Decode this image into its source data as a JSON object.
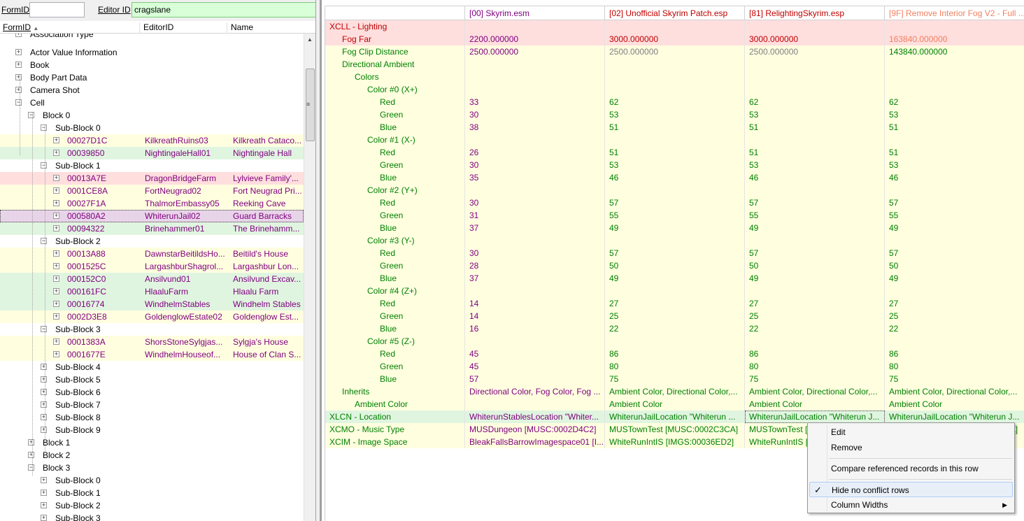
{
  "filter": {
    "formid_label": "FormID",
    "formid_value": "",
    "editorid_label": "Editor ID",
    "editorid_value": "cragslane"
  },
  "tree_header": {
    "col_formid": "FormID",
    "col_editorid": "EditorID",
    "col_name": "Name",
    "sort_icon": "sort-ascending-icon"
  },
  "tree_rows": [
    {
      "level": 1,
      "label": "Association Type",
      "exp": "+",
      "bg": "",
      "partial": true
    },
    {
      "level": 1,
      "label": "Actor Value Information",
      "exp": "+",
      "bg": ""
    },
    {
      "level": 1,
      "label": "Book",
      "exp": "+",
      "bg": ""
    },
    {
      "level": 1,
      "label": "Body Part Data",
      "exp": "+",
      "bg": ""
    },
    {
      "level": 1,
      "label": "Camera Shot",
      "exp": "+",
      "bg": ""
    },
    {
      "level": 1,
      "label": "Cell",
      "exp": "−",
      "bg": ""
    },
    {
      "level": 2,
      "label": "Block 0",
      "exp": "−",
      "bg": ""
    },
    {
      "level": 3,
      "label": "Sub-Block 0",
      "exp": "−",
      "bg": ""
    },
    {
      "level": 4,
      "formid": "00027D1C",
      "editorid": "KilkreathRuins03",
      "name": "Kilkreath Cataco...",
      "exp": "+",
      "bg": "y"
    },
    {
      "level": 4,
      "formid": "00039850",
      "editorid": "NightingaleHall01",
      "name": "Nightingale Hall",
      "exp": "+",
      "bg": "g"
    },
    {
      "level": 3,
      "label": "Sub-Block 1",
      "exp": "−",
      "bg": ""
    },
    {
      "level": 4,
      "formid": "00013A7E",
      "editorid": "DragonBridgeFarm",
      "name": "Lylvieve Family'...",
      "exp": "+",
      "bg": "r"
    },
    {
      "level": 4,
      "formid": "0001CE8A",
      "editorid": "FortNeugrad02",
      "name": "Fort Neugrad Pri...",
      "exp": "+",
      "bg": "y"
    },
    {
      "level": 4,
      "formid": "00027F1A",
      "editorid": "ThalmorEmbassy05",
      "name": "Reeking Cave",
      "exp": "+",
      "bg": "y"
    },
    {
      "level": 4,
      "formid": "000580A2",
      "editorid": "WhiterunJail02",
      "name": "Guard Barracks",
      "exp": "+",
      "bg": "p",
      "selected": true
    },
    {
      "level": 4,
      "formid": "00094322",
      "editorid": "Brinehammer01",
      "name": "The Brinehamm...",
      "exp": "+",
      "bg": "g"
    },
    {
      "level": 3,
      "label": "Sub-Block 2",
      "exp": "−",
      "bg": ""
    },
    {
      "level": 4,
      "formid": "00013A88",
      "editorid": "DawnstarBeitildsHo...",
      "name": "Beitild's House",
      "exp": "+",
      "bg": "y"
    },
    {
      "level": 4,
      "formid": "0001525C",
      "editorid": "LargashburShagrol...",
      "name": "Largashbur Lon...",
      "exp": "+",
      "bg": "y"
    },
    {
      "level": 4,
      "formid": "000152C0",
      "editorid": "Ansilvund01",
      "name": "Ansilvund Excav...",
      "exp": "+",
      "bg": "g"
    },
    {
      "level": 4,
      "formid": "000161FC",
      "editorid": "HlaaluFarm",
      "name": "Hlaalu Farm",
      "exp": "+",
      "bg": "g"
    },
    {
      "level": 4,
      "formid": "00016774",
      "editorid": "WindhelmStables",
      "name": "Windhelm Stables",
      "exp": "+",
      "bg": "g"
    },
    {
      "level": 4,
      "formid": "0002D3E8",
      "editorid": "GoldenglowEstate02",
      "name": "Goldenglow Est...",
      "exp": "+",
      "bg": "y"
    },
    {
      "level": 3,
      "label": "Sub-Block 3",
      "exp": "−",
      "bg": ""
    },
    {
      "level": 4,
      "formid": "0001383A",
      "editorid": "ShorsStoneSylgjas...",
      "name": "Sylgja's House",
      "exp": "+",
      "bg": "y"
    },
    {
      "level": 4,
      "formid": "0001677E",
      "editorid": "WindhelmHouseof...",
      "name": "House of Clan S...",
      "exp": "+",
      "bg": "y"
    },
    {
      "level": 3,
      "label": "Sub-Block 4",
      "exp": "+",
      "bg": ""
    },
    {
      "level": 3,
      "label": "Sub-Block 5",
      "exp": "+",
      "bg": ""
    },
    {
      "level": 3,
      "label": "Sub-Block 6",
      "exp": "+",
      "bg": ""
    },
    {
      "level": 3,
      "label": "Sub-Block 7",
      "exp": "+",
      "bg": ""
    },
    {
      "level": 3,
      "label": "Sub-Block 8",
      "exp": "+",
      "bg": ""
    },
    {
      "level": 3,
      "label": "Sub-Block 9",
      "exp": "+",
      "bg": ""
    },
    {
      "level": 2,
      "label": "Block 1",
      "exp": "+",
      "bg": ""
    },
    {
      "level": 2,
      "label": "Block 2",
      "exp": "+",
      "bg": ""
    },
    {
      "level": 2,
      "label": "Block 3",
      "exp": "−",
      "bg": ""
    },
    {
      "level": 3,
      "label": "Sub-Block 0",
      "exp": "+",
      "bg": ""
    },
    {
      "level": 3,
      "label": "Sub-Block 1",
      "exp": "+",
      "bg": ""
    },
    {
      "level": 3,
      "label": "Sub-Block 2",
      "exp": "+",
      "bg": ""
    },
    {
      "level": 3,
      "label": "Sub-Block 3",
      "exp": "+",
      "bg": ""
    }
  ],
  "grid_header": [
    {
      "text": "",
      "color": ""
    },
    {
      "text": "[00] Skyrim.esm",
      "color": "purple"
    },
    {
      "text": "[02] Unofficial Skyrim Patch.esp",
      "color": "red"
    },
    {
      "text": "[81] RelightingSkyrim.esp",
      "color": "red"
    },
    {
      "text": "[9F] Remove Interior Fog V2 - Full ...",
      "color": "orange"
    }
  ],
  "grid_rows": [
    {
      "lvl": 0,
      "label": "XCLL - Lighting",
      "lc": "red",
      "bg": "r",
      "v": [
        "",
        "",
        "",
        ""
      ],
      "vc": [
        "",
        "",
        "",
        ""
      ]
    },
    {
      "lvl": 1,
      "label": "Fog Far",
      "lc": "red",
      "bg": "r",
      "v": [
        "2200.000000",
        "3000.000000",
        "3000.000000",
        "163840.000000"
      ],
      "vc": [
        "purple",
        "red",
        "red",
        "orange"
      ]
    },
    {
      "lvl": 1,
      "label": "Fog Clip Distance",
      "lc": "green",
      "bg": "y",
      "v": [
        "2500.000000",
        "2500.000000",
        "2500.000000",
        "143840.000000"
      ],
      "vc": [
        "purple",
        "gray",
        "gray",
        "green"
      ]
    },
    {
      "lvl": 1,
      "label": "Directional Ambient",
      "lc": "green",
      "bg": "y",
      "v": [
        "",
        "",
        "",
        ""
      ],
      "vc": [
        "",
        "",
        "",
        ""
      ]
    },
    {
      "lvl": 2,
      "label": "Colors",
      "lc": "green",
      "bg": "y",
      "v": [
        "",
        "",
        "",
        ""
      ],
      "vc": [
        "",
        "",
        "",
        ""
      ]
    },
    {
      "lvl": 3,
      "label": "Color #0 (X+)",
      "lc": "green",
      "bg": "y",
      "v": [
        "",
        "",
        "",
        ""
      ],
      "vc": [
        "",
        "",
        "",
        ""
      ]
    },
    {
      "lvl": 4,
      "label": "Red",
      "lc": "green",
      "bg": "y",
      "v": [
        "33",
        "62",
        "62",
        "62"
      ],
      "vc": [
        "purple",
        "green",
        "green",
        "green"
      ]
    },
    {
      "lvl": 4,
      "label": "Green",
      "lc": "green",
      "bg": "y",
      "v": [
        "30",
        "53",
        "53",
        "53"
      ],
      "vc": [
        "purple",
        "green",
        "green",
        "green"
      ]
    },
    {
      "lvl": 4,
      "label": "Blue",
      "lc": "green",
      "bg": "y",
      "v": [
        "38",
        "51",
        "51",
        "51"
      ],
      "vc": [
        "purple",
        "green",
        "green",
        "green"
      ]
    },
    {
      "lvl": 3,
      "label": "Color #1 (X-)",
      "lc": "green",
      "bg": "y",
      "v": [
        "",
        "",
        "",
        ""
      ],
      "vc": [
        "",
        "",
        "",
        ""
      ]
    },
    {
      "lvl": 4,
      "label": "Red",
      "lc": "green",
      "bg": "y",
      "v": [
        "26",
        "51",
        "51",
        "51"
      ],
      "vc": [
        "purple",
        "green",
        "green",
        "green"
      ]
    },
    {
      "lvl": 4,
      "label": "Green",
      "lc": "green",
      "bg": "y",
      "v": [
        "30",
        "53",
        "53",
        "53"
      ],
      "vc": [
        "purple",
        "green",
        "green",
        "green"
      ]
    },
    {
      "lvl": 4,
      "label": "Blue",
      "lc": "green",
      "bg": "y",
      "v": [
        "35",
        "46",
        "46",
        "46"
      ],
      "vc": [
        "purple",
        "green",
        "green",
        "green"
      ]
    },
    {
      "lvl": 3,
      "label": "Color #2 (Y+)",
      "lc": "green",
      "bg": "y",
      "v": [
        "",
        "",
        "",
        ""
      ],
      "vc": [
        "",
        "",
        "",
        ""
      ]
    },
    {
      "lvl": 4,
      "label": "Red",
      "lc": "green",
      "bg": "y",
      "v": [
        "30",
        "57",
        "57",
        "57"
      ],
      "vc": [
        "purple",
        "green",
        "green",
        "green"
      ]
    },
    {
      "lvl": 4,
      "label": "Green",
      "lc": "green",
      "bg": "y",
      "v": [
        "31",
        "55",
        "55",
        "55"
      ],
      "vc": [
        "purple",
        "green",
        "green",
        "green"
      ]
    },
    {
      "lvl": 4,
      "label": "Blue",
      "lc": "green",
      "bg": "y",
      "v": [
        "37",
        "49",
        "49",
        "49"
      ],
      "vc": [
        "purple",
        "green",
        "green",
        "green"
      ]
    },
    {
      "lvl": 3,
      "label": "Color #3 (Y-)",
      "lc": "green",
      "bg": "y",
      "v": [
        "",
        "",
        "",
        ""
      ],
      "vc": [
        "",
        "",
        "",
        ""
      ]
    },
    {
      "lvl": 4,
      "label": "Red",
      "lc": "green",
      "bg": "y",
      "v": [
        "30",
        "57",
        "57",
        "57"
      ],
      "vc": [
        "purple",
        "green",
        "green",
        "green"
      ]
    },
    {
      "lvl": 4,
      "label": "Green",
      "lc": "green",
      "bg": "y",
      "v": [
        "28",
        "50",
        "50",
        "50"
      ],
      "vc": [
        "purple",
        "green",
        "green",
        "green"
      ]
    },
    {
      "lvl": 4,
      "label": "Blue",
      "lc": "green",
      "bg": "y",
      "v": [
        "37",
        "49",
        "49",
        "49"
      ],
      "vc": [
        "purple",
        "green",
        "green",
        "green"
      ]
    },
    {
      "lvl": 3,
      "label": "Color #4 (Z+)",
      "lc": "green",
      "bg": "y",
      "v": [
        "",
        "",
        "",
        ""
      ],
      "vc": [
        "",
        "",
        "",
        ""
      ]
    },
    {
      "lvl": 4,
      "label": "Red",
      "lc": "green",
      "bg": "y",
      "v": [
        "14",
        "27",
        "27",
        "27"
      ],
      "vc": [
        "purple",
        "green",
        "green",
        "green"
      ]
    },
    {
      "lvl": 4,
      "label": "Green",
      "lc": "green",
      "bg": "y",
      "v": [
        "14",
        "25",
        "25",
        "25"
      ],
      "vc": [
        "purple",
        "green",
        "green",
        "green"
      ]
    },
    {
      "lvl": 4,
      "label": "Blue",
      "lc": "green",
      "bg": "y",
      "v": [
        "16",
        "22",
        "22",
        "22"
      ],
      "vc": [
        "purple",
        "green",
        "green",
        "green"
      ]
    },
    {
      "lvl": 3,
      "label": "Color #5 (Z-)",
      "lc": "green",
      "bg": "y",
      "v": [
        "",
        "",
        "",
        ""
      ],
      "vc": [
        "",
        "",
        "",
        ""
      ]
    },
    {
      "lvl": 4,
      "label": "Red",
      "lc": "green",
      "bg": "y",
      "v": [
        "45",
        "86",
        "86",
        "86"
      ],
      "vc": [
        "purple",
        "green",
        "green",
        "green"
      ]
    },
    {
      "lvl": 4,
      "label": "Green",
      "lc": "green",
      "bg": "y",
      "v": [
        "45",
        "80",
        "80",
        "80"
      ],
      "vc": [
        "purple",
        "green",
        "green",
        "green"
      ]
    },
    {
      "lvl": 4,
      "label": "Blue",
      "lc": "green",
      "bg": "y",
      "v": [
        "57",
        "75",
        "75",
        "75"
      ],
      "vc": [
        "purple",
        "green",
        "green",
        "green"
      ]
    },
    {
      "lvl": 1,
      "label": "Inherits",
      "lc": "green",
      "bg": "y",
      "v": [
        "Directional Color, Fog Color, Fog ...",
        "Ambient Color, Directional Color,...",
        "Ambient Color, Directional Color,...",
        "Ambient Color, Directional Color,..."
      ],
      "vc": [
        "purple",
        "green",
        "green",
        "green"
      ]
    },
    {
      "lvl": 2,
      "label": "Ambient Color",
      "lc": "green",
      "bg": "y",
      "v": [
        "",
        "Ambient Color",
        "Ambient Color",
        "Ambient Color"
      ],
      "vc": [
        "",
        "green",
        "green",
        "green"
      ]
    },
    {
      "lvl": 0,
      "label": "XLCN - Location",
      "lc": "green",
      "bg": "g",
      "v": [
        "WhiterunStablesLocation \"Whiter...",
        "WhiterunJailLocation \"Whiterun ...",
        "WhiterunJailLocation \"Whiterun J...",
        "WhiterunJailLocation \"Whiterun J..."
      ],
      "vc": [
        "purple",
        "green",
        "green",
        "green"
      ],
      "focus": true
    },
    {
      "lvl": 0,
      "label": "XCMO - Music Type",
      "lc": "green",
      "bg": "y",
      "v": [
        "MUSDungeon [MUSC:0002D4C2]",
        "MUSTownTest [MUSC:0002C3CA]",
        "MUSTownTest [MUSC:0002C3CA]",
        "MUSTownTest [MUSC:0002C3CA]"
      ],
      "vc": [
        "purple",
        "green",
        "green",
        "green"
      ]
    },
    {
      "lvl": 0,
      "label": "XCIM - Image Space",
      "lc": "green",
      "bg": "y",
      "v": [
        "BleakFallsBarrowImagespace01 [I...",
        "WhiteRunIntIS [IMGS:00036ED2]",
        "WhiteRunIntIS [IMGS:00036ED2]",
        "WhiteRunIntIS [IMGS:00036ED2]"
      ],
      "vc": [
        "purple",
        "green",
        "green",
        "green"
      ]
    }
  ],
  "context_menu": {
    "edit": "Edit",
    "remove": "Remove",
    "compare": "Compare referenced records in this row",
    "hide": "Hide no conflict rows",
    "hide_checked": true,
    "column_widths": "Column Widths"
  },
  "colors": {
    "purple": "#800080",
    "green": "#008000",
    "red": "#c00000",
    "orange": "#f08060",
    "yellow_bg": "#ffffe0",
    "red_bg": "#ffdede",
    "green_bg": "#e0f5e0"
  }
}
